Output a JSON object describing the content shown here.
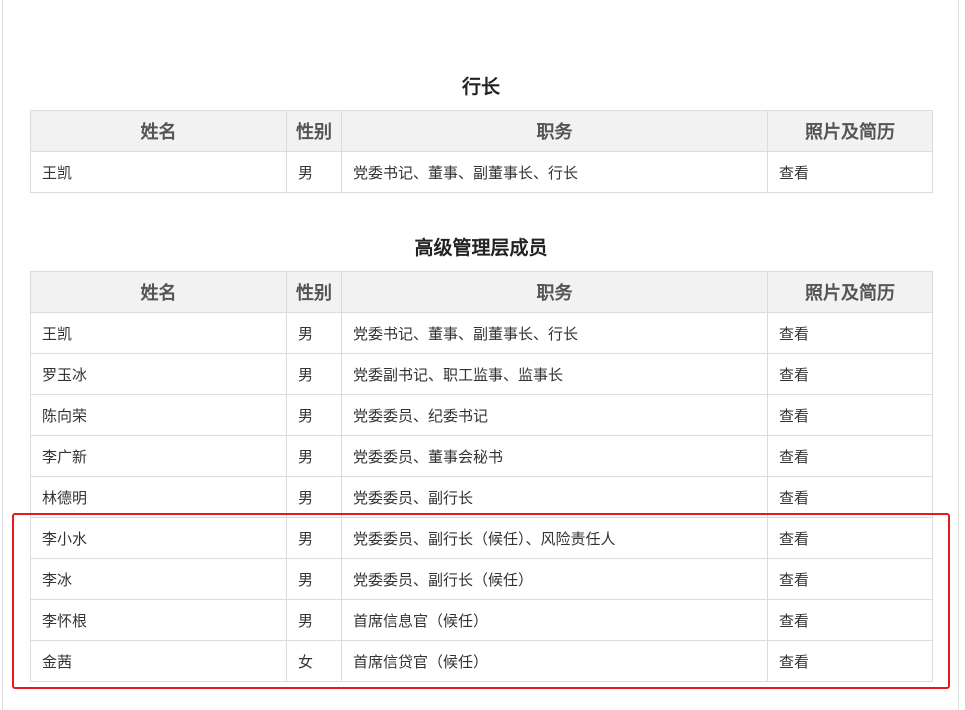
{
  "sections": [
    {
      "title": "行长",
      "headers": [
        "姓名",
        "性别",
        "职务",
        "照片及简历"
      ],
      "rows": [
        {
          "name": "王凯",
          "gender": "男",
          "position": "党委书记、董事、副董事长、行长",
          "link": "查看"
        }
      ]
    },
    {
      "title": "高级管理层成员",
      "headers": [
        "姓名",
        "性别",
        "职务",
        "照片及简历"
      ],
      "rows": [
        {
          "name": "王凯",
          "gender": "男",
          "position": "党委书记、董事、副董事长、行长",
          "link": "查看"
        },
        {
          "name": "罗玉冰",
          "gender": "男",
          "position": "党委副书记、职工监事、监事长",
          "link": "查看"
        },
        {
          "name": "陈向荣",
          "gender": "男",
          "position": "党委委员、纪委书记",
          "link": "查看"
        },
        {
          "name": "李广新",
          "gender": "男",
          "position": "党委委员、董事会秘书",
          "link": "查看"
        },
        {
          "name": "林德明",
          "gender": "男",
          "position": "党委委员、副行长",
          "link": "查看"
        },
        {
          "name": "李小水",
          "gender": "男",
          "position": "党委委员、副行长（候任）、风险责任人",
          "link": "查看"
        },
        {
          "name": "李冰",
          "gender": "男",
          "position": "党委委员、副行长（候任）",
          "link": "查看"
        },
        {
          "name": "李怀根",
          "gender": "男",
          "position": "首席信息官（候任）",
          "link": "查看"
        },
        {
          "name": "金茜",
          "gender": "女",
          "position": "首席信贷官（候任）",
          "link": "查看"
        }
      ]
    }
  ],
  "colors": {
    "highlight": "#e8191c",
    "header_bg": "#f2f2f2",
    "border": "#dcdcdc"
  }
}
